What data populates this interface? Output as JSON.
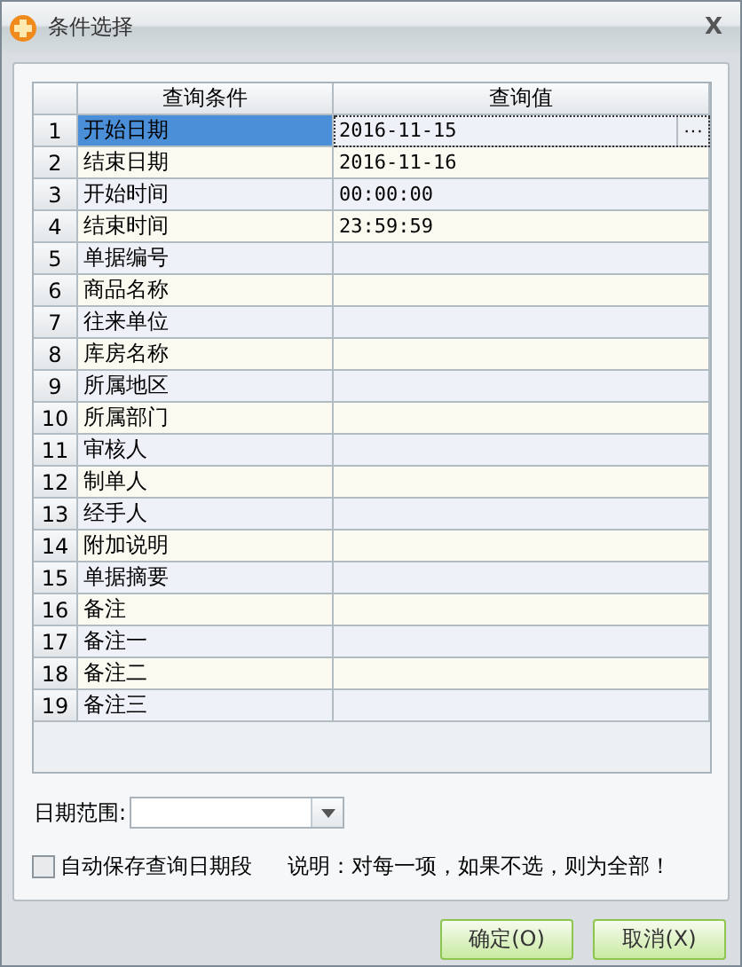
{
  "window": {
    "title": "条件选择",
    "close": "X"
  },
  "table": {
    "columns": [
      "查询条件",
      "查询值"
    ],
    "rows": [
      {
        "number": "1",
        "condition": "开始日期",
        "value": "2016-11-15",
        "selected": true,
        "ellipsis": "···"
      },
      {
        "number": "2",
        "condition": "结束日期",
        "value": "2016-11-16",
        "selected": false
      },
      {
        "number": "3",
        "condition": "开始时间",
        "value": "00:00:00",
        "selected": false
      },
      {
        "number": "4",
        "condition": "结束时间",
        "value": "23:59:59",
        "selected": false
      },
      {
        "number": "5",
        "condition": "单据编号",
        "selected": false
      },
      {
        "number": "6",
        "condition": "商品名称",
        "selected": false
      },
      {
        "number": "7",
        "condition": "往来单位",
        "selected": false
      },
      {
        "number": "8",
        "condition": "库房名称",
        "selected": false
      },
      {
        "number": "9",
        "condition": "所属地区",
        "selected": false
      },
      {
        "number": "10",
        "condition": "所属部门",
        "selected": false
      },
      {
        "number": "11",
        "condition": "审核人",
        "selected": false
      },
      {
        "number": "12",
        "condition": "制单人",
        "selected": false
      },
      {
        "number": "13",
        "condition": "经手人",
        "selected": false
      },
      {
        "number": "14",
        "condition": "附加说明",
        "selected": false
      },
      {
        "number": "15",
        "condition": "单据摘要",
        "selected": false
      },
      {
        "number": "16",
        "condition": "备注",
        "selected": false
      },
      {
        "number": "17",
        "condition": "备注一",
        "selected": false
      },
      {
        "number": "18",
        "condition": "备注二",
        "selected": false
      },
      {
        "number": "19",
        "condition": "备注三",
        "selected": false
      }
    ]
  },
  "date_range": {
    "label": "日期范围:"
  },
  "auto_save": {
    "label": "自动保存查询日期段",
    "checked": false
  },
  "note": "说明：对每一项，如果不选，则为全部！",
  "buttons": [
    "确定(O)",
    "取消(X)"
  ]
}
